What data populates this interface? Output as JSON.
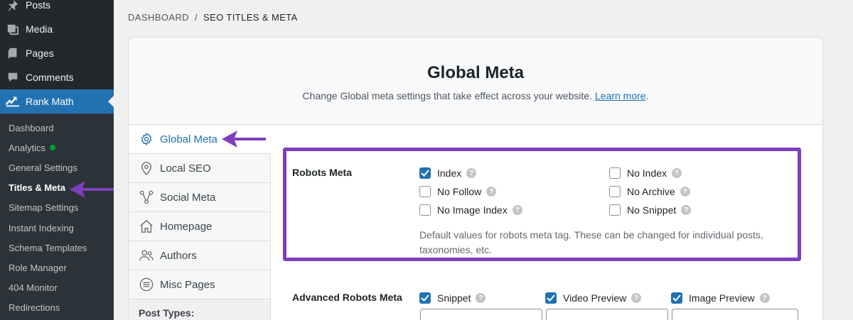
{
  "sidebar": {
    "top_items": [
      {
        "label": "Posts",
        "icon": "pin-icon"
      },
      {
        "label": "Media",
        "icon": "media-icon"
      },
      {
        "label": "Pages",
        "icon": "pages-icon"
      },
      {
        "label": "Comments",
        "icon": "comments-icon"
      },
      {
        "label": "Rank Math",
        "icon": "rankmath-icon"
      }
    ],
    "sub_items": [
      "Dashboard",
      "Analytics",
      "General Settings",
      "Titles & Meta",
      "Sitemap Settings",
      "Instant Indexing",
      "Schema Templates",
      "Role Manager",
      "404 Monitor",
      "Redirections"
    ]
  },
  "breadcrumb": {
    "root": "DASHBOARD",
    "sep": "/",
    "current": "SEO TITLES & META"
  },
  "header": {
    "title": "Global Meta",
    "description": "Change Global meta settings that take effect across your website.",
    "link": "Learn more",
    "period": "."
  },
  "tabs": [
    "Global Meta",
    "Local SEO",
    "Social Meta",
    "Homepage",
    "Authors",
    "Misc Pages"
  ],
  "tabs_section_label": "Post Types:",
  "robots_meta": {
    "label": "Robots Meta",
    "options": [
      {
        "label": "Index",
        "checked": true
      },
      {
        "label": "No Index",
        "checked": false
      },
      {
        "label": "No Follow",
        "checked": false
      },
      {
        "label": "No Archive",
        "checked": false
      },
      {
        "label": "No Image Index",
        "checked": false
      },
      {
        "label": "No Snippet",
        "checked": false
      }
    ],
    "note": "Default values for robots meta tag. These can be changed for individual posts, taxonomies, etc."
  },
  "advanced_robots": {
    "label": "Advanced Robots Meta",
    "options": [
      {
        "label": "Snippet",
        "checked": true
      },
      {
        "label": "Video Preview",
        "checked": true
      },
      {
        "label": "Image Preview",
        "checked": true
      }
    ]
  },
  "help_glyph": "?",
  "colors": {
    "accent": "#2271b1",
    "highlight": "#7e3fbc",
    "sidebar": "#23282d"
  }
}
